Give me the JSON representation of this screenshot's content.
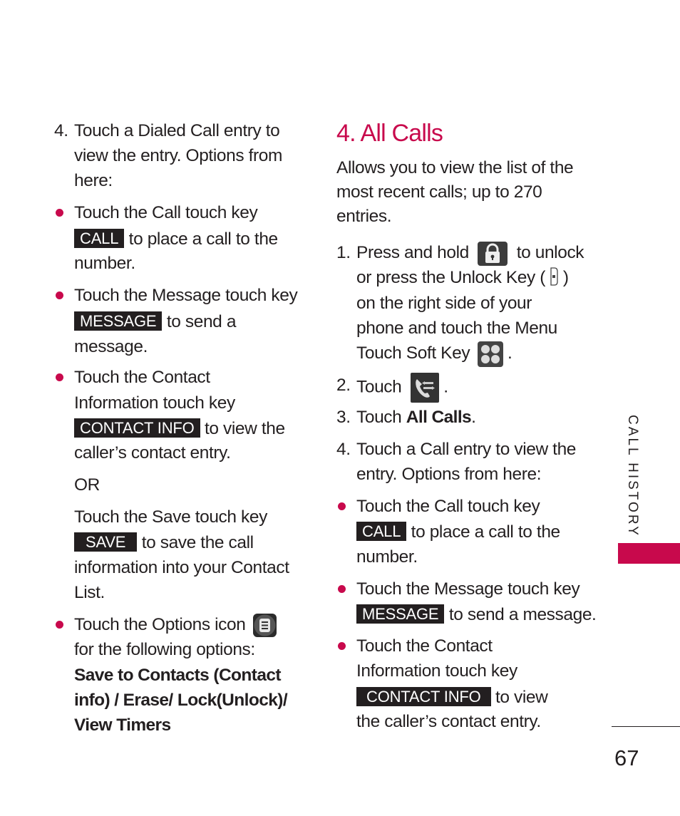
{
  "colors": {
    "accent": "#c8094c",
    "text": "#231f20",
    "key_bg": "#231f20",
    "key_text": "#ffffff"
  },
  "left_column": {
    "step4": {
      "number": "4.",
      "lines": [
        "Touch a Dialed Call entry to",
        "view the entry. Options from",
        "here:"
      ]
    },
    "bullets": [
      {
        "line1": "Touch the Call touch key",
        "key": "CALL",
        "after_key": "to place a call to the",
        "line3": "number."
      },
      {
        "line1": "Touch the Message touch key",
        "key": "MESSAGE",
        "after_key": "to send a",
        "line3": "message."
      },
      {
        "line1": "Touch the Contact",
        "line2": "Information touch key",
        "key": "CONTACT INFO",
        "after_key": "to view the",
        "line4": "caller’s contact entry."
      }
    ],
    "or_label": "OR",
    "save": {
      "line1": "Touch the Save touch key",
      "key": "SAVE",
      "after_key": "to save the call",
      "line3": "information into your Contact",
      "line4": "List."
    },
    "options": {
      "line1": "Touch the Options icon",
      "icon": "options-menu-icon",
      "line2": "for the following options:",
      "bold_lines": [
        "Save to Contacts (Contact",
        "info) / Erase/ Lock(Unlock)/",
        "View Timers"
      ]
    }
  },
  "right_column": {
    "section_title": "4. All Calls",
    "intro_lines": [
      "Allows you to view the list of the",
      "most recent calls; up to 270",
      "entries."
    ],
    "step1": {
      "number": "1.",
      "line1_a": "Press and hold",
      "lock_icon": "lock-icon",
      "line1_b": "to unlock",
      "line2_a": "or press the Unlock Key (",
      "unlock_key_icon": "side-unlock-key-icon",
      "line2_b": ")",
      "line3": "on the right side of your",
      "line4": "phone and touch the Menu",
      "line5": "Touch Soft Key",
      "menu_icon": "menu-grid-icon",
      "line5_end": "."
    },
    "step2": {
      "number": "2.",
      "text": "Touch",
      "icon": "call-history-icon",
      "end": "."
    },
    "step3": {
      "number": "3.",
      "text": "Touch ",
      "bold": "All Calls",
      "end": "."
    },
    "step4": {
      "number": "4.",
      "lines": [
        "Touch a Call entry to view the",
        "entry. Options from here:"
      ]
    },
    "bullets": [
      {
        "line1": "Touch the Call touch key",
        "key": "CALL",
        "after_key": "to place a call to the",
        "line3": "number."
      },
      {
        "line1": "Touch the Message touch key",
        "key": "MESSAGE",
        "after_key": "to send a message."
      },
      {
        "line1": "Touch the Contact",
        "line2": "Information touch key",
        "key": "CONTACT INFO",
        "after_key": "to view",
        "line4": "the caller’s contact entry."
      }
    ]
  },
  "side_tab": {
    "label": "CALL HISTORY"
  },
  "page_number": "67"
}
